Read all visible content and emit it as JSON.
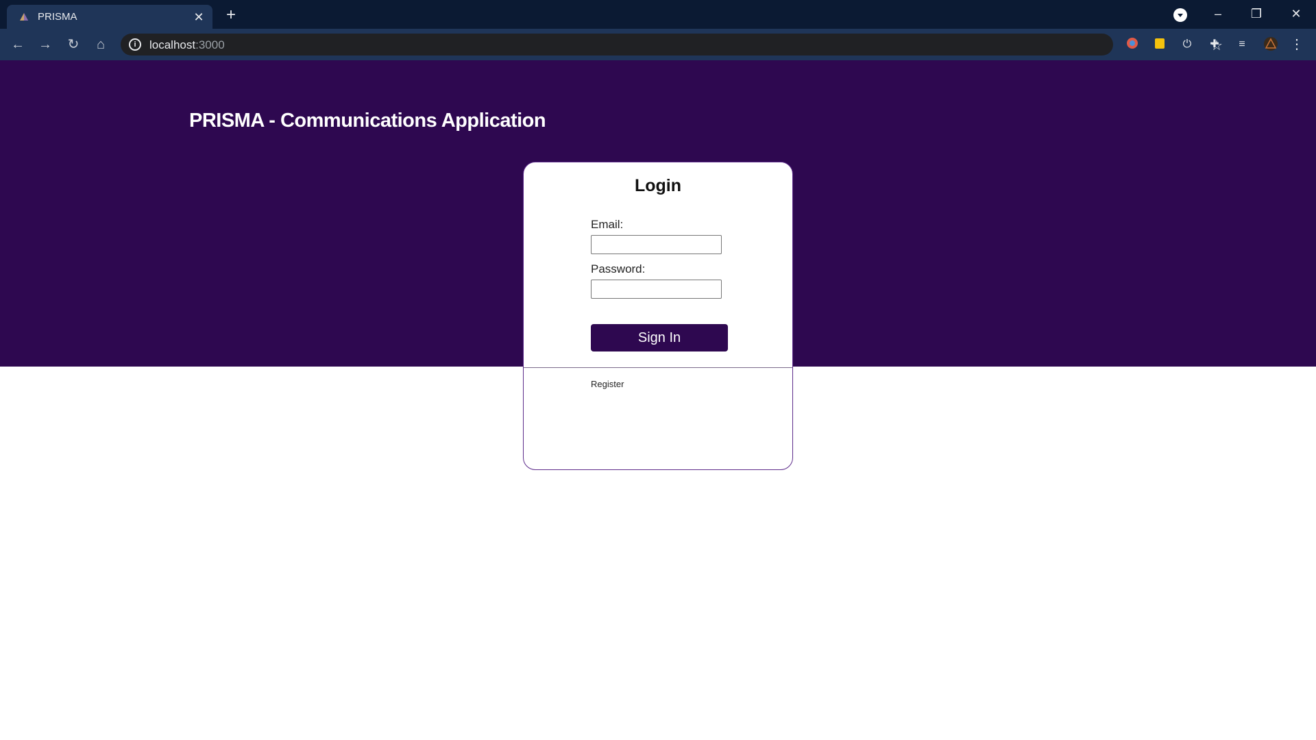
{
  "browser": {
    "tab_title": "PRISMA",
    "url_host": "localhost",
    "url_port": ":3000",
    "icons": {
      "favicon": "prisma-favicon-icon",
      "close": "close-tab-icon",
      "new_tab": "plus-icon",
      "profile": "profile-dropdown-icon",
      "minimize": "minimize-icon",
      "restore": "restore-icon",
      "close_window": "close-window-icon",
      "back": "back-arrow-icon",
      "forward": "forward-arrow-icon",
      "reload": "reload-icon",
      "home": "home-icon",
      "info": "info-icon",
      "bookmark": "star-icon",
      "extensions": [
        "extension-1-icon",
        "extension-2-icon",
        "power-icon",
        "puzzle-icon",
        "media-icon",
        "account-icon"
      ],
      "menu": "kebab-menu-icon"
    }
  },
  "page": {
    "app_title": "PRISMA - Communications Application",
    "colors": {
      "hero_bg": "#2e0850",
      "button_bg": "#2e0850"
    },
    "login": {
      "title": "Login",
      "email_label": "Email:",
      "email_value": "",
      "password_label": "Password:",
      "password_value": "",
      "submit_label": "Sign In",
      "register_link": "Register"
    }
  }
}
